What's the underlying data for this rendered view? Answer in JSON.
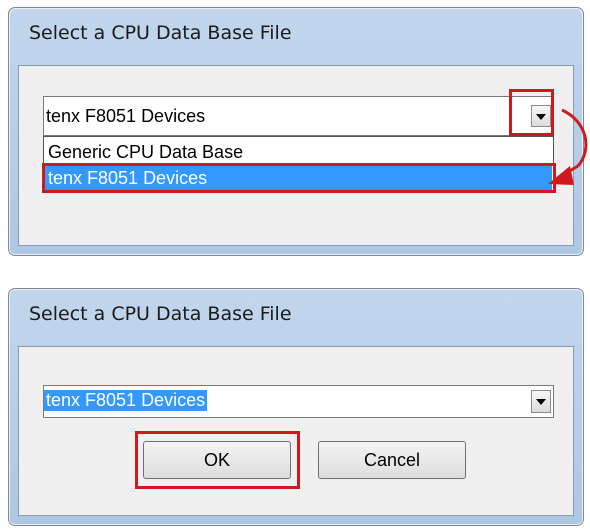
{
  "dialog1": {
    "title": "Select a CPU Data Base File",
    "combo_value": "tenx F8051 Devices",
    "dropdown_options": [
      "Generic CPU Data Base",
      "tenx F8051 Devices"
    ],
    "selected_option_index": 1
  },
  "dialog2": {
    "title": "Select a CPU Data Base File",
    "combo_value": "tenx F8051 Devices",
    "ok_label": "OK",
    "cancel_label": "Cancel"
  },
  "colors": {
    "highlight": "#d0191f",
    "selection": "#3399ff",
    "title_bar": "#c2d6ec"
  }
}
